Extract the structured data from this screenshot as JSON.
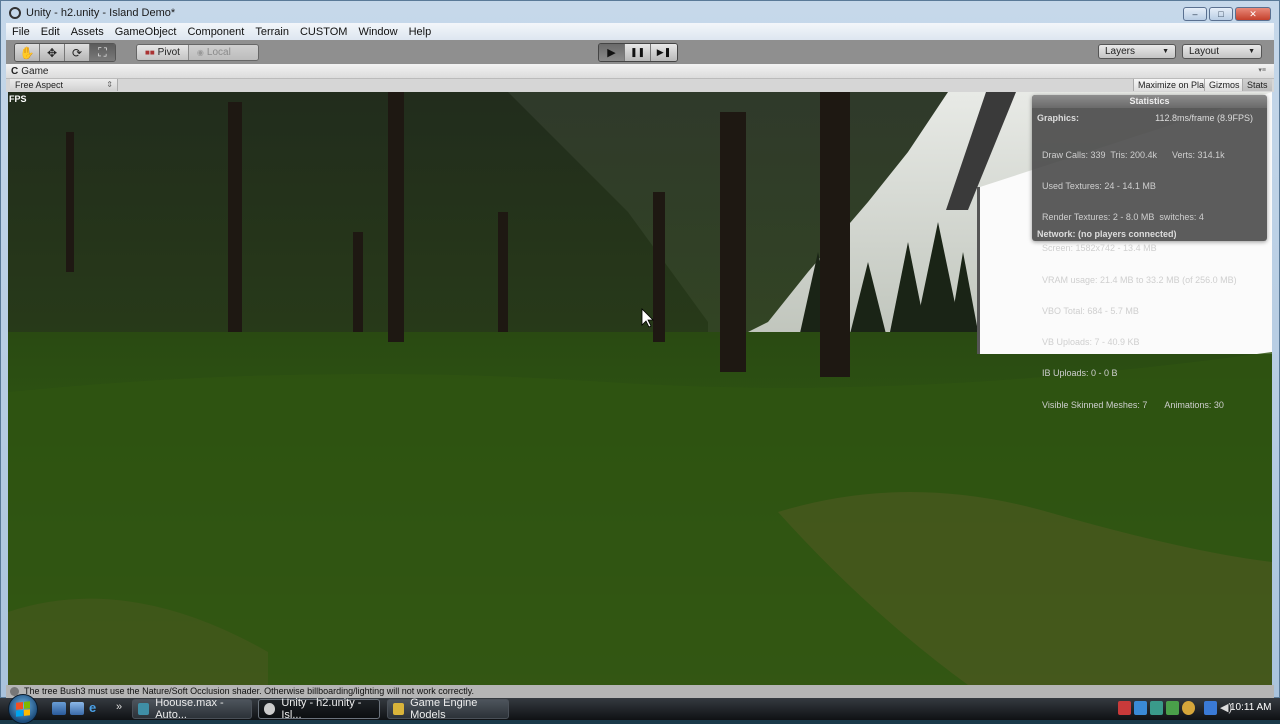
{
  "window": {
    "title": "Unity - h2.unity - Island Demo*",
    "controls": {
      "minimize": "–",
      "maximize": "□",
      "close": "✕"
    }
  },
  "menubar": {
    "items": [
      "File",
      "Edit",
      "Assets",
      "GameObject",
      "Component",
      "Terrain",
      "CUSTOM",
      "Window",
      "Help"
    ]
  },
  "toolbar": {
    "transform_tools": [
      {
        "name": "hand-tool",
        "glyph": "✋"
      },
      {
        "name": "move-tool",
        "glyph": "✥"
      },
      {
        "name": "rotate-tool",
        "glyph": "⟳"
      },
      {
        "name": "scale-tool",
        "glyph": "⛶",
        "active": true
      }
    ],
    "pivot_label": "Pivot",
    "local_label": "Local",
    "play": {
      "play": "▶",
      "pause": "❚❚",
      "step": "▶❚"
    },
    "layers_label": "Layers",
    "layout_label": "Layout"
  },
  "game_view": {
    "tab_label": "Game",
    "aspect": "Free Aspect",
    "maximize_on_play": "Maximize on Play",
    "gizmos": "Gizmos",
    "stats": "Stats",
    "fps_label": "FPS",
    "statistics": {
      "title": "Statistics",
      "graphics_label": "Graphics:",
      "frame_time": "112.8ms/frame (8.9FPS)",
      "lines": [
        "Draw Calls: 339  Tris: 200.4k      Verts: 314.1k",
        "Used Textures: 24 - 14.1 MB",
        "Render Textures: 2 - 8.0 MB  switches: 4",
        "Screen: 1582x742 - 13.4 MB",
        "VRAM usage: 21.4 MB to 33.2 MB (of 256.0 MB)",
        "VBO Total: 684 - 5.7 MB",
        "VB Uploads: 7 - 40.9 KB",
        "IB Uploads: 0 - 0 B",
        "Visible Skinned Meshes: 7       Animations: 30"
      ],
      "network": "Network: (no players connected)"
    }
  },
  "statusbar": {
    "message": "The tree Bush3 must use the Nature/Soft Occlusion shader. Otherwise billboarding/lighting will not work correctly."
  },
  "taskbar": {
    "tasks": [
      {
        "label": "Hoouse.max - Auto...",
        "active": false,
        "icon_color": "#3f8fa6"
      },
      {
        "label": "Unity - h2.unity - Isl...",
        "active": true,
        "icon_color": "#cccccc"
      },
      {
        "label": "Game Engine Models",
        "active": false,
        "icon_color": "#d9b43a"
      }
    ],
    "quick_launch_chevron": "»",
    "clock": "10:11 AM"
  },
  "colors": {
    "toolbar_bg": "#8f8f8f",
    "stats_bg": "#464646",
    "grass": "#2f5a14",
    "sky": "#d9dcd9"
  }
}
